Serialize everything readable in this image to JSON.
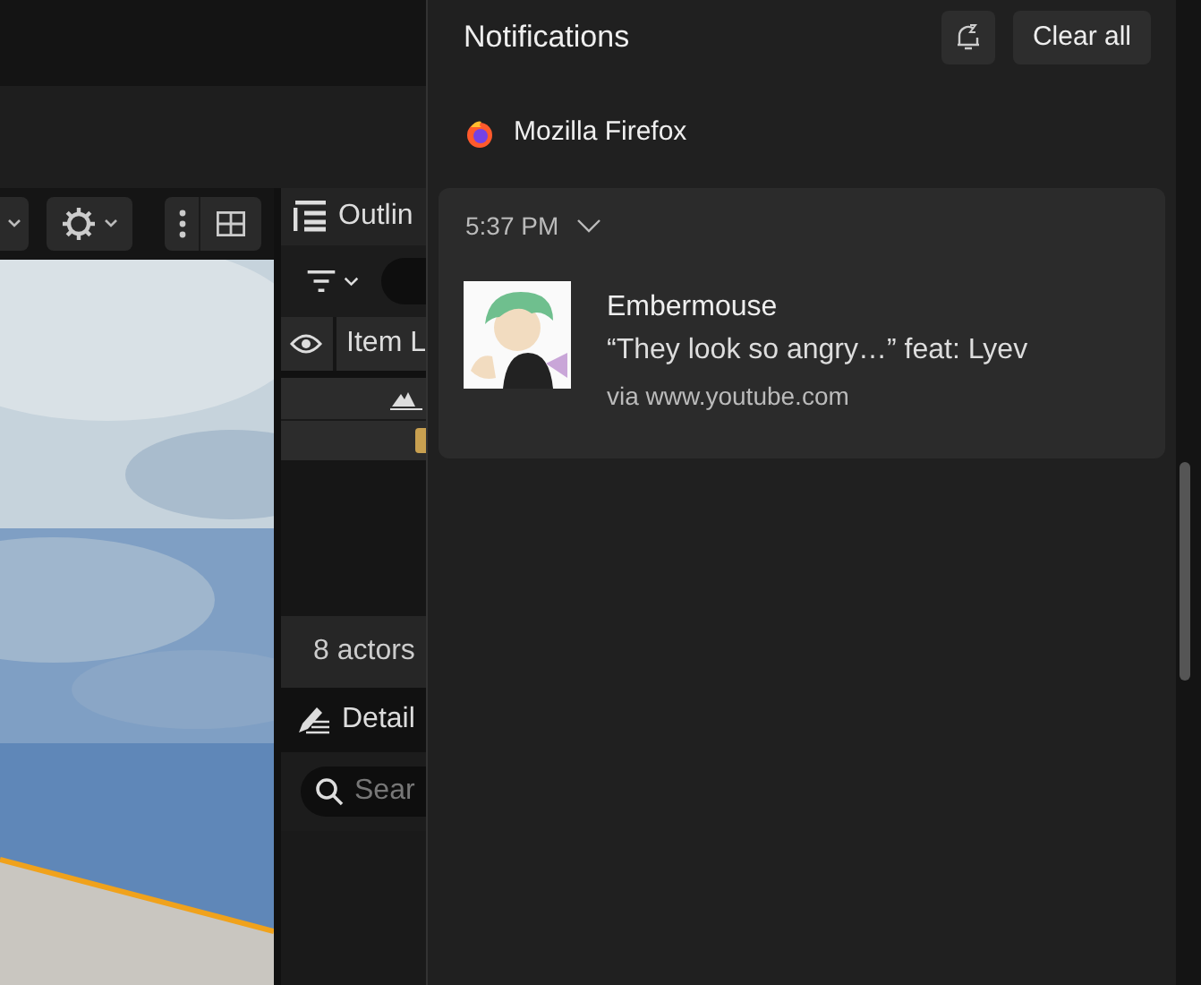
{
  "editor": {
    "outliner": {
      "title": "Outlin",
      "column_1": "Item L",
      "status": "8 actors"
    },
    "details": {
      "title": "Detail",
      "search": {
        "placeholder": "Sear"
      }
    }
  },
  "notifications": {
    "title": "Notifications",
    "clear_button": "Clear all",
    "apps": [
      {
        "name": "Mozilla Firefox",
        "items": [
          {
            "time": "5:37 PM",
            "title": "Embermouse",
            "body": "“They look so angry…” feat: Lyev",
            "source": "via www.youtube.com"
          }
        ]
      }
    ]
  }
}
